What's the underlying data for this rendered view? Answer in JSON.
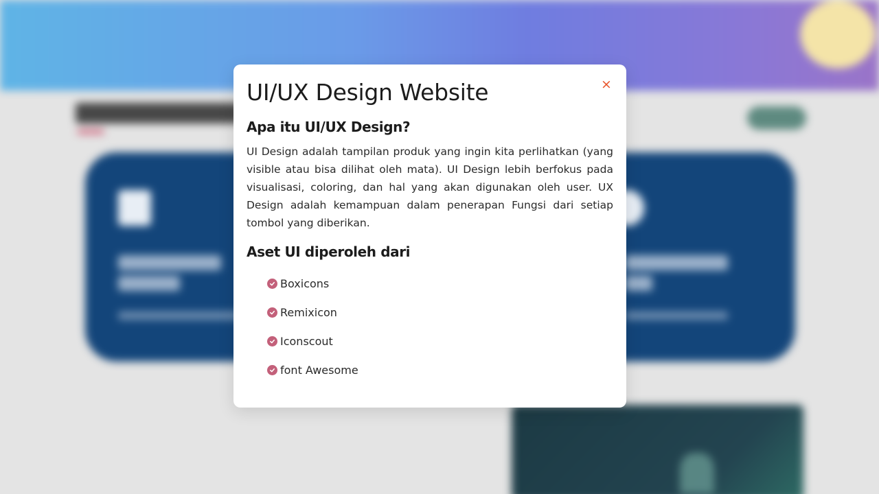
{
  "modal": {
    "title": "UI/UX Design Website",
    "close_label": "×",
    "section1_heading": "Apa itu UI/UX Design?",
    "section1_body": "UI Design adalah tampilan produk yang ingin kita perlihatkan (yang visible atau bisa dilihat oleh mata). UI Design lebih berfokus pada visualisasi, coloring, dan hal yang akan digunakan oleh user. UX Design adalah kemampuan dalam penerapan Fungsi dari setiap tombol yang diberikan.",
    "section2_heading": "Aset UI diperoleh dari",
    "assets": [
      {
        "label": "Boxicons",
        "icon": "check-circle-icon"
      },
      {
        "label": "Remixicon",
        "icon": "check-circle-icon"
      },
      {
        "label": "Iconscout",
        "icon": "check-circle-icon"
      },
      {
        "label": "font Awesome",
        "icon": "check-circle-icon"
      }
    ]
  },
  "colors": {
    "close_icon": "#e8542a",
    "check_icon": "#c3607a",
    "modal_background": "#ffffff",
    "card_background": "#13457a"
  }
}
